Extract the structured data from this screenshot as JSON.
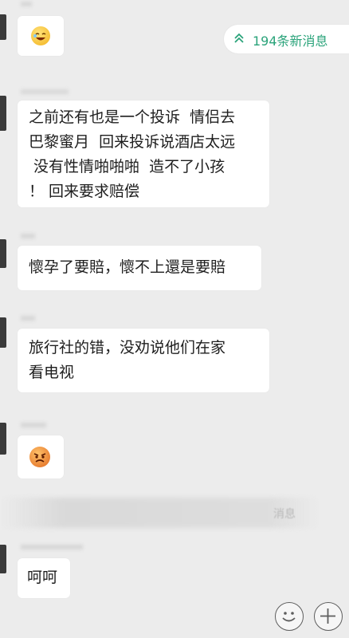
{
  "new_messages": {
    "label": "194条新消息",
    "chevron": "chevrons-up-icon"
  },
  "messages": [
    {
      "type": "sticker",
      "icon": "laughing-face-icon"
    },
    {
      "type": "text",
      "lines": [
        "之前还有也是一个投诉  情侣去",
        "巴黎蜜月  回来投诉说酒店太远",
        " 没有性情啪啪啪  造不了小孩",
        "！ 回来要求赔偿"
      ]
    },
    {
      "type": "text",
      "lines": [
        "懷孕了要賠，懷不上還是要賠"
      ]
    },
    {
      "type": "text",
      "lines": [
        "旅行社的错，没劝说他们在家",
        "看电视"
      ]
    },
    {
      "type": "sticker",
      "icon": "angry-face-icon"
    },
    {
      "type": "text",
      "lines": [
        "呵呵"
      ]
    }
  ],
  "blurred_notice": "消息",
  "input_bar": {
    "emoji_button": "smiley-icon",
    "plus_button": "plus-icon"
  },
  "colors": {
    "accent": "#2aa37a",
    "bubble": "#ffffff",
    "background": "#ececec"
  }
}
